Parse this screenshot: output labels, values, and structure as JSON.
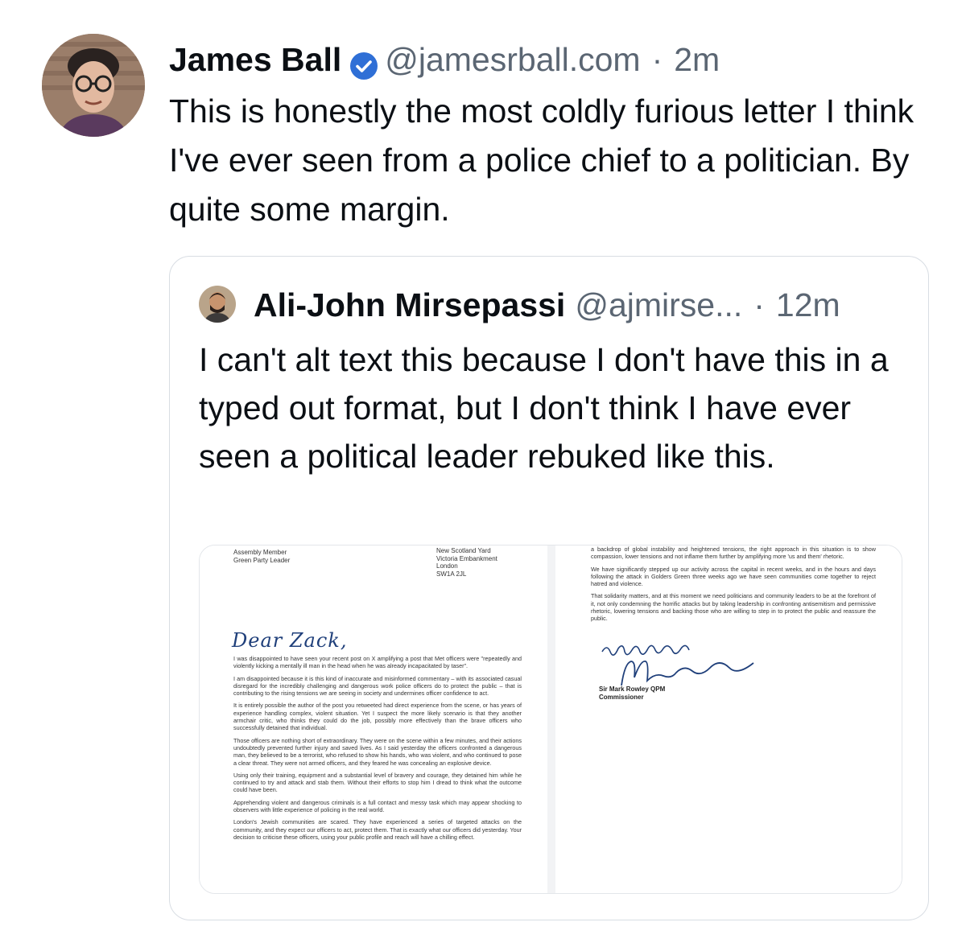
{
  "post": {
    "author_name": "James Ball",
    "verified_icon": "verified-badge-icon",
    "handle": "@jamesrball.com",
    "separator": "·",
    "time": "2m",
    "text": "This is honestly the most coldly furious letter I think I've ever seen from a police chief to a politician. By quite some margin."
  },
  "quote": {
    "author_name": "Ali-John Mirsepassi",
    "handle": "@ajmirse...",
    "separator": "·",
    "time": "12m",
    "text": "I can't alt text this because I don't have this in a typed out format, but I don't think I have ever seen a political leader rebuked like this."
  },
  "letter": {
    "page1": {
      "from_line1": "Assembly Member",
      "from_line2": "Green Party Leader",
      "addr_line1": "New Scotland Yard",
      "addr_line2": "Victoria Embankment",
      "addr_line3": "London",
      "addr_line4": "SW1A 2JL",
      "salutation": "Dear Zack,",
      "paragraphs": [
        "I was disappointed to have seen your recent post on X amplifying a post that Met officers were \"repeatedly and violently kicking a mentally ill man in the head when he was already incapacitated by taser\".",
        "I am disappointed because it is this kind of inaccurate and misinformed commentary – with its associated casual disregard for the incredibly challenging and dangerous work police officers do to protect the public – that is contributing to the rising tensions we are seeing in society and undermines officer confidence to act.",
        "It is entirely possible the author of the post you retweeted had direct experience from the scene, or has years of experience handling complex, violent situation. Yet I suspect the more likely scenario is that they another armchair critic, who thinks they could do the job, possibly more effectively than the brave officers who successfully detained that individual.",
        "Those officers are nothing short of extraordinary. They were on the scene within a few minutes, and their actions undoubtedly prevented further injury and saved lives. As I said yesterday the officers confronted a dangerous man, they believed to be a terrorist, who refused to show his hands, who was violent, and who continued to pose a clear threat. They were not armed officers, and they feared he was concealing an explosive device.",
        "Using only their training, equipment and a substantial level of bravery and courage, they detained him while he continued to try and attack and stab them. Without their efforts to stop him I dread to think what the outcome could have been.",
        "Apprehending violent and dangerous criminals is a full contact and messy task which may appear shocking to observers with little experience of policing in the real world.",
        "London's Jewish communities are scared. They have experienced a series of targeted attacks on the community, and they expect our officers to act, protect them. That is exactly what our officers did yesterday. Your decision to criticise these officers, using your public profile and reach will have a chilling effect."
      ]
    },
    "page2": {
      "paragraphs": [
        "a backdrop of global instability and heightened tensions, the right approach in this situation is to show compassion, lower tensions and not inflame them further by amplifying more 'us and them' rhetoric.",
        "We have significantly stepped up our activity across the capital in recent weeks, and in the hours and days following the attack in Golders Green three weeks ago we have seen communities come together to reject hatred and violence.",
        "That solidarity matters, and at this moment we need politicians and community leaders to be at the forefront of it, not only condemning the horrific attacks but by taking leadership in confronting antisemitism and permissive rhetoric, lowering tensions and backing those who are willing to step in to protect the public and reassure the public."
      ],
      "closing": "yours sincerely",
      "signatory": "Sir Mark Rowley QPM",
      "signatory_title": "Commissioner"
    }
  },
  "colors": {
    "text": "#0b0f14",
    "secondary": "#5b6673",
    "verified": "#2f6fd6",
    "border": "#d8dde3",
    "ink": "#1f3f7a"
  }
}
